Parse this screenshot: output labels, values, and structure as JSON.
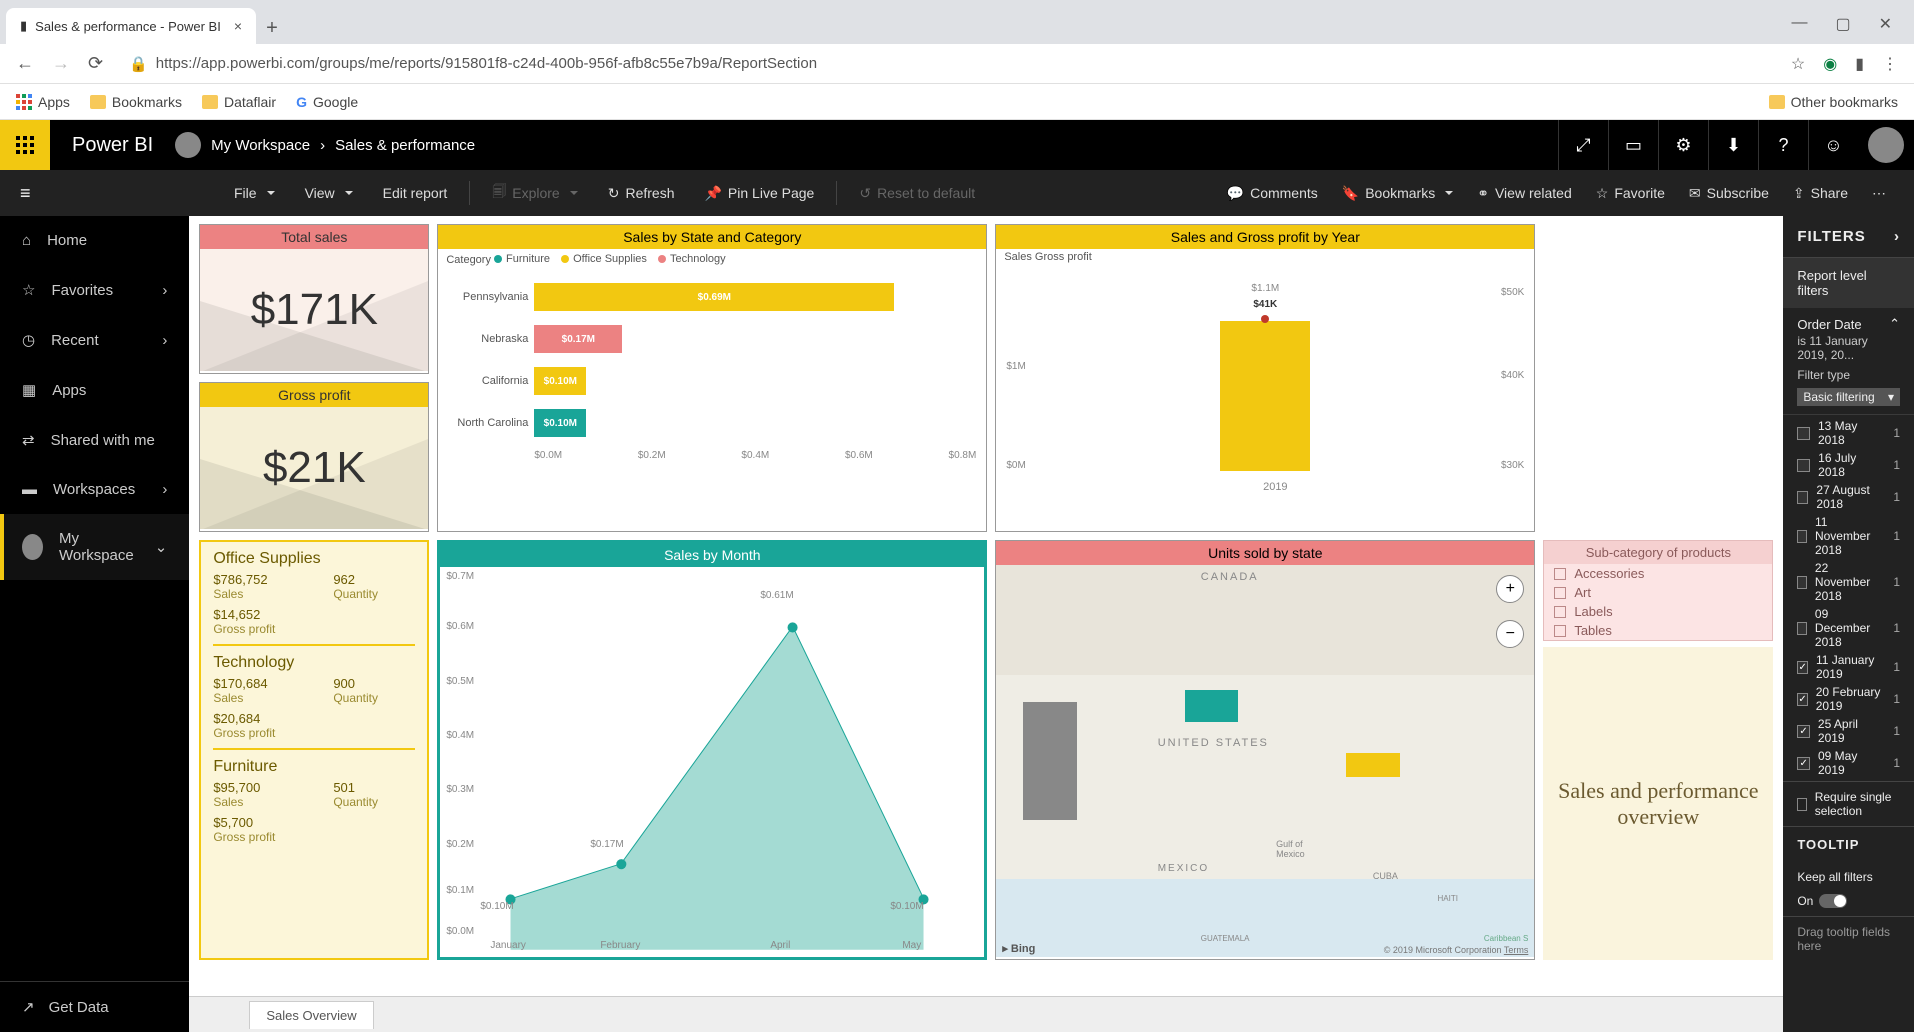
{
  "browser": {
    "tab_title": "Sales & performance - Power BI",
    "url": "https://app.powerbi.com/groups/me/reports/915801f8-c24d-400b-956f-afb8c55e7b9a/ReportSection",
    "bookmarks": [
      "Apps",
      "Bookmarks",
      "Dataflair",
      "Google"
    ],
    "other_bookmarks": "Other bookmarks"
  },
  "header": {
    "product": "Power BI",
    "workspace": "My Workspace",
    "report": "Sales & performance"
  },
  "toolbar": {
    "file": "File",
    "view": "View",
    "edit": "Edit report",
    "explore": "Explore",
    "refresh": "Refresh",
    "pin": "Pin Live Page",
    "reset": "Reset to default",
    "comments": "Comments",
    "bookmarks": "Bookmarks",
    "related": "View related",
    "favorite": "Favorite",
    "subscribe": "Subscribe",
    "share": "Share"
  },
  "leftnav": {
    "home": "Home",
    "favorites": "Favorites",
    "recent": "Recent",
    "apps": "Apps",
    "shared": "Shared with me",
    "workspaces": "Workspaces",
    "myworkspace": "My Workspace",
    "getdata": "Get Data"
  },
  "kpi": {
    "total_sales_title": "Total sales",
    "total_sales_value": "$171K",
    "gross_profit_title": "Gross profit",
    "gross_profit_value": "$21K"
  },
  "barchart": {
    "title": "Sales by State and Category",
    "legend_label": "Category",
    "legend": [
      "Furniture",
      "Office Supplies",
      "Technology"
    ],
    "rows": [
      {
        "state": "Pennsylvania",
        "label": "$0.69M"
      },
      {
        "state": "Nebraska",
        "label": "$0.17M"
      },
      {
        "state": "California",
        "label": "$0.10M"
      },
      {
        "state": "North Carolina",
        "label": "$0.10M"
      }
    ],
    "xaxis": [
      "$0.0M",
      "$0.2M",
      "$0.4M",
      "$0.6M",
      "$0.8M"
    ]
  },
  "combo": {
    "title": "Sales and Gross profit by Year",
    "legend": [
      "Sales",
      "Gross profit"
    ],
    "left_ticks": [
      "$1M",
      "$0M"
    ],
    "right_ticks": [
      "$50K",
      "$40K",
      "$30K"
    ],
    "bar_top_label": "$1.1M",
    "bar_data_label": "$41K",
    "xlabel": "2019"
  },
  "categories": [
    {
      "name": "Office Supplies",
      "sales": "$786,752",
      "qty": "962",
      "gp": "$14,652"
    },
    {
      "name": "Technology",
      "sales": "$170,684",
      "qty": "900",
      "gp": "$20,684"
    },
    {
      "name": "Furniture",
      "sales": "$95,700",
      "qty": "501",
      "gp": "$5,700"
    }
  ],
  "cat_labels": {
    "sales": "Sales",
    "qty": "Quantity",
    "gp": "Gross profit"
  },
  "area": {
    "title": "Sales by Month",
    "yticks": [
      "$0.7M",
      "$0.6M",
      "$0.5M",
      "$0.4M",
      "$0.3M",
      "$0.2M",
      "$0.1M",
      "$0.0M"
    ],
    "xticks": [
      "January",
      "February",
      "April",
      "May"
    ],
    "point_labels": [
      "$0.10M",
      "$0.17M",
      "$0.61M",
      "$0.10M"
    ]
  },
  "map": {
    "title": "Units sold by state",
    "labels": {
      "canada": "CANADA",
      "us": "UNITED STATES",
      "mexico": "MEXICO",
      "gulf": "Gulf of\nMexico",
      "cuba": "CUBA",
      "haiti": "HAITI",
      "guat": "GUATEMALA",
      "carib": "Caribbean S"
    },
    "bing": "Bing",
    "credits": "© 2019 Microsoft Corporation",
    "terms": "Terms"
  },
  "subcat": {
    "title": "Sub-category of products",
    "items": [
      "Accessories",
      "Art",
      "Labels",
      "Tables"
    ]
  },
  "overview_title": "Sales and performance overview",
  "pagetab": "Sales Overview",
  "filters": {
    "header": "FILTERS",
    "level": "Report level filters",
    "field": "Order Date",
    "summary": "is 11 January 2019, 20...",
    "typelbl": "Filter type",
    "type": "Basic filtering",
    "items": [
      {
        "label": "13 May 2018",
        "checked": false,
        "count": "1"
      },
      {
        "label": "16 July 2018",
        "checked": false,
        "count": "1"
      },
      {
        "label": "27 August 2018",
        "checked": false,
        "count": "1"
      },
      {
        "label": "11 November 2018",
        "checked": false,
        "count": "1"
      },
      {
        "label": "22 November 2018",
        "checked": false,
        "count": "1"
      },
      {
        "label": "09 December 2018",
        "checked": false,
        "count": "1"
      },
      {
        "label": "11 January 2019",
        "checked": true,
        "count": "1"
      },
      {
        "label": "20 February 2019",
        "checked": true,
        "count": "1"
      },
      {
        "label": "25 April 2019",
        "checked": true,
        "count": "1"
      },
      {
        "label": "09 May 2019",
        "checked": true,
        "count": "1"
      }
    ],
    "reqsingle": "Require single selection",
    "tooltip_hdr": "TOOLTIP",
    "keepall": "Keep all filters",
    "on": "On",
    "drag": "Drag tooltip fields here"
  },
  "chart_data": [
    {
      "type": "bar",
      "title": "Sales by State and Category",
      "orientation": "horizontal",
      "categories": [
        "Pennsylvania",
        "Nebraska",
        "California",
        "North Carolina"
      ],
      "legend": [
        "Furniture",
        "Office Supplies",
        "Technology"
      ],
      "values_m": [
        0.69,
        0.17,
        0.1,
        0.1
      ],
      "colors": [
        "#f2c811",
        "#ec8282",
        "#f2c811",
        "#19a598"
      ],
      "xlabel": "",
      "ylabel": "",
      "xlim": [
        0,
        0.8
      ],
      "unit": "$M"
    },
    {
      "type": "bar+line",
      "title": "Sales and Gross profit by Year",
      "categories": [
        "2019"
      ],
      "series": [
        {
          "name": "Sales",
          "axis": "left",
          "values_m": [
            1.1
          ],
          "unit": "$M"
        },
        {
          "name": "Gross profit",
          "axis": "right",
          "values_k": [
            41
          ],
          "unit": "$K"
        }
      ],
      "left_ylim_m": [
        0,
        1.2
      ],
      "right_ylim_k": [
        30,
        50
      ]
    },
    {
      "type": "area",
      "title": "Sales by Month",
      "x": [
        "January",
        "February",
        "April",
        "May"
      ],
      "values_m": [
        0.1,
        0.17,
        0.61,
        0.1
      ],
      "ylim_m": [
        0,
        0.7
      ],
      "unit": "$M"
    },
    {
      "type": "table",
      "title": "Category summary",
      "columns": [
        "Category",
        "Sales",
        "Quantity",
        "Gross profit"
      ],
      "rows": [
        [
          "Office Supplies",
          786752,
          962,
          14652
        ],
        [
          "Technology",
          170684,
          900,
          20684
        ],
        [
          "Furniture",
          95700,
          501,
          5700
        ]
      ]
    }
  ]
}
